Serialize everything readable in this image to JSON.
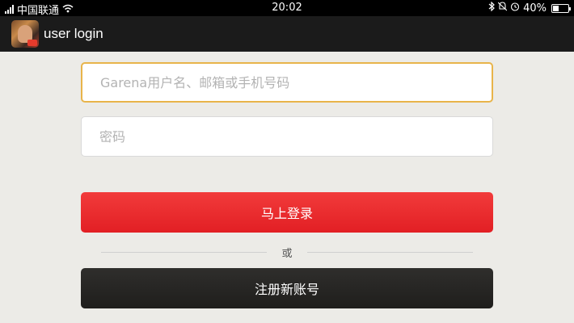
{
  "status_bar": {
    "carrier": "中国联通",
    "time": "20:02",
    "battery_text": "40%",
    "battery_level": 0.4,
    "icons": [
      "signal-icon",
      "wifi-icon",
      "bluetooth-icon",
      "mute-icon",
      "alarm-icon",
      "battery-icon"
    ]
  },
  "header": {
    "title": "user login",
    "icon": "app-game-icon"
  },
  "form": {
    "username_placeholder": "Garena用户名、邮箱或手机号码",
    "username_value": "",
    "password_placeholder": "密码",
    "password_value": "",
    "login_label": "马上登录",
    "or_label": "或",
    "register_label": "注册新账号"
  },
  "colors": {
    "login_button": "#e8232a",
    "register_button": "#272624",
    "focus_border": "#e8b44a",
    "background": "#ecebe7"
  }
}
